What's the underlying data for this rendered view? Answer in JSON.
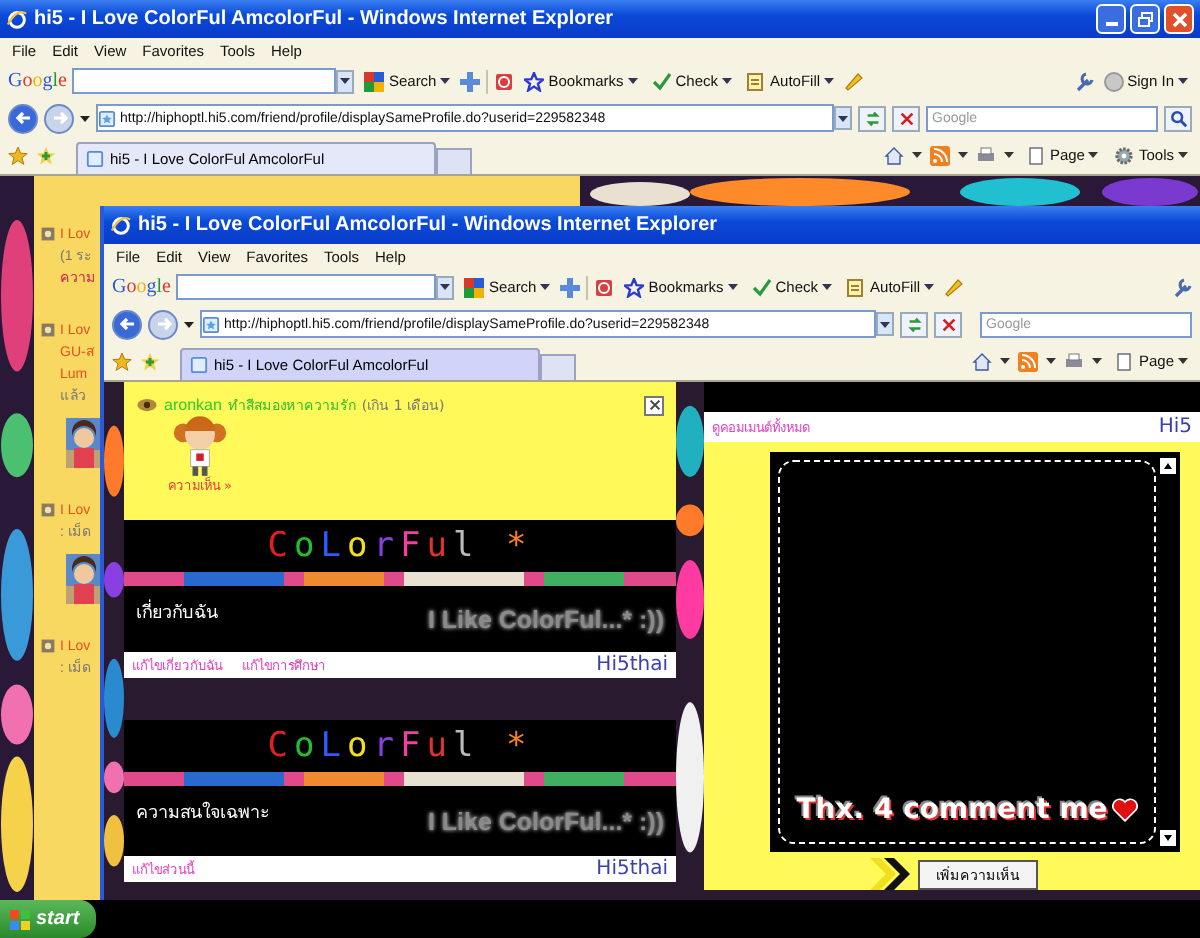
{
  "windows": [
    {
      "title": "hi5 - I Love ColorFul AmcolorFul - Windows Internet Explorer",
      "menu": [
        "File",
        "Edit",
        "View",
        "Favorites",
        "Tools",
        "Help"
      ],
      "google": {
        "logo": "Google",
        "search": "Search",
        "bookmarks": "Bookmarks",
        "check": "Check",
        "autofill": "AutoFill",
        "sign_in": "Sign In"
      },
      "address": "http://hiphoptl.hi5.com/friend/profile/displaySameProfile.do?userid=229582348",
      "search_placeholder": "Google",
      "tab": "hi5 - I Love ColorFul AmcolorFul",
      "commands": [
        "Page",
        "Tools"
      ]
    },
    {
      "title": "hi5 - I Love ColorFul AmcolorFul - Windows Internet Explorer",
      "menu": [
        "File",
        "Edit",
        "View",
        "Favorites",
        "Tools",
        "Help"
      ],
      "google": {
        "logo": "Google",
        "search": "Search",
        "bookmarks": "Bookmarks",
        "check": "Check",
        "autofill": "AutoFill"
      },
      "address": "http://hiphoptl.hi5.com/friend/profile/displaySameProfile.do?userid=229582348",
      "search_placeholder": "Google",
      "tab": "hi5 - I Love ColorFul AmcolorFul",
      "commands": [
        "Page"
      ]
    }
  ],
  "back_page": {
    "entries": [
      {
        "lines": [
          {
            "text": "I Lov",
            "kind": "title"
          },
          {
            "text": "(1 ระ",
            "kind": "note"
          },
          {
            "text": "ความ",
            "kind": "link"
          }
        ]
      },
      {
        "lines": [
          {
            "text": "I Lov",
            "kind": "title"
          },
          {
            "text": "GU-ส",
            "kind": "title"
          },
          {
            "text": "Lum",
            "kind": "title"
          },
          {
            "text": "แล้ว",
            "kind": "note"
          }
        ],
        "photo": true
      },
      {
        "lines": [
          {
            "text": "I Lov",
            "kind": "title"
          },
          {
            "text": ": เม็ด",
            "kind": "note"
          }
        ],
        "photo": true
      },
      {
        "lines": [
          {
            "text": "I Lov",
            "kind": "title"
          },
          {
            "text": ": เม็ด",
            "kind": "note"
          }
        ]
      }
    ]
  },
  "profile": {
    "header": {
      "name": "aronkan",
      "status": "ทำสีสมองหาความรัก",
      "age": "(เกิน 1 เดือน)",
      "comment_link": "ความเห็น »"
    },
    "sections": [
      {
        "banner": "CoLorFul *",
        "heading": "เกี่ยวกับฉัน",
        "slogan": "I Like ColorFul...* :))",
        "links": [
          "แก้ไขเกี่ยวกับฉัน",
          "แก้ไขการศึกษา"
        ],
        "logo": "Hi5thai"
      },
      {
        "banner": "CoLorFul *",
        "heading": "ความสนใจเฉพาะ",
        "slogan": "I Like ColorFul...* :))",
        "links": [
          "แก้ไขส่วนนี้"
        ],
        "logo": "Hi5thai"
      }
    ]
  },
  "comments": {
    "title_link": "ดูคอมเมนต์ทั้งหมด",
    "logo": "Hi5",
    "message": "Thx. 4 comment me",
    "button": "เพิ่มความเห็น"
  },
  "taskbar": {
    "start": "start"
  }
}
